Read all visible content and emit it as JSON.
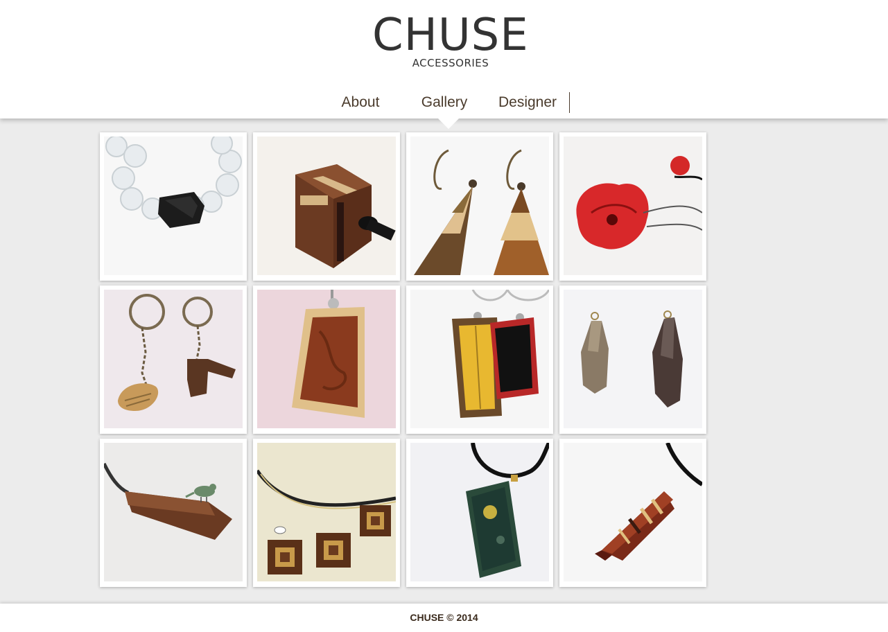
{
  "brand": {
    "name": "CHUSE",
    "tagline": "ACCESSORIES"
  },
  "nav": {
    "items": [
      "About",
      "Gallery",
      "Designer"
    ],
    "active": "Gallery"
  },
  "gallery": {
    "items": [
      {
        "label": "Bracelet with clear beads and black wooden bead"
      },
      {
        "label": "Striped wooden cube pendant"
      },
      {
        "label": "Triangular wooden earrings"
      },
      {
        "label": "Red enamel flower ring"
      },
      {
        "label": "Wooden bird and shape keychains"
      },
      {
        "label": "Burl wood rectangular pendant"
      },
      {
        "label": "Striped and red wooden pendants"
      },
      {
        "label": "Faceted wooden pendants"
      },
      {
        "label": "Wooden crystal pendant with bird"
      },
      {
        "label": "Wooden square inlay necklace"
      },
      {
        "label": "Green stone rectangular pendant"
      },
      {
        "label": "Striped faceted wooden pendant"
      }
    ]
  },
  "footer": {
    "text": "CHUSE © 2014"
  }
}
